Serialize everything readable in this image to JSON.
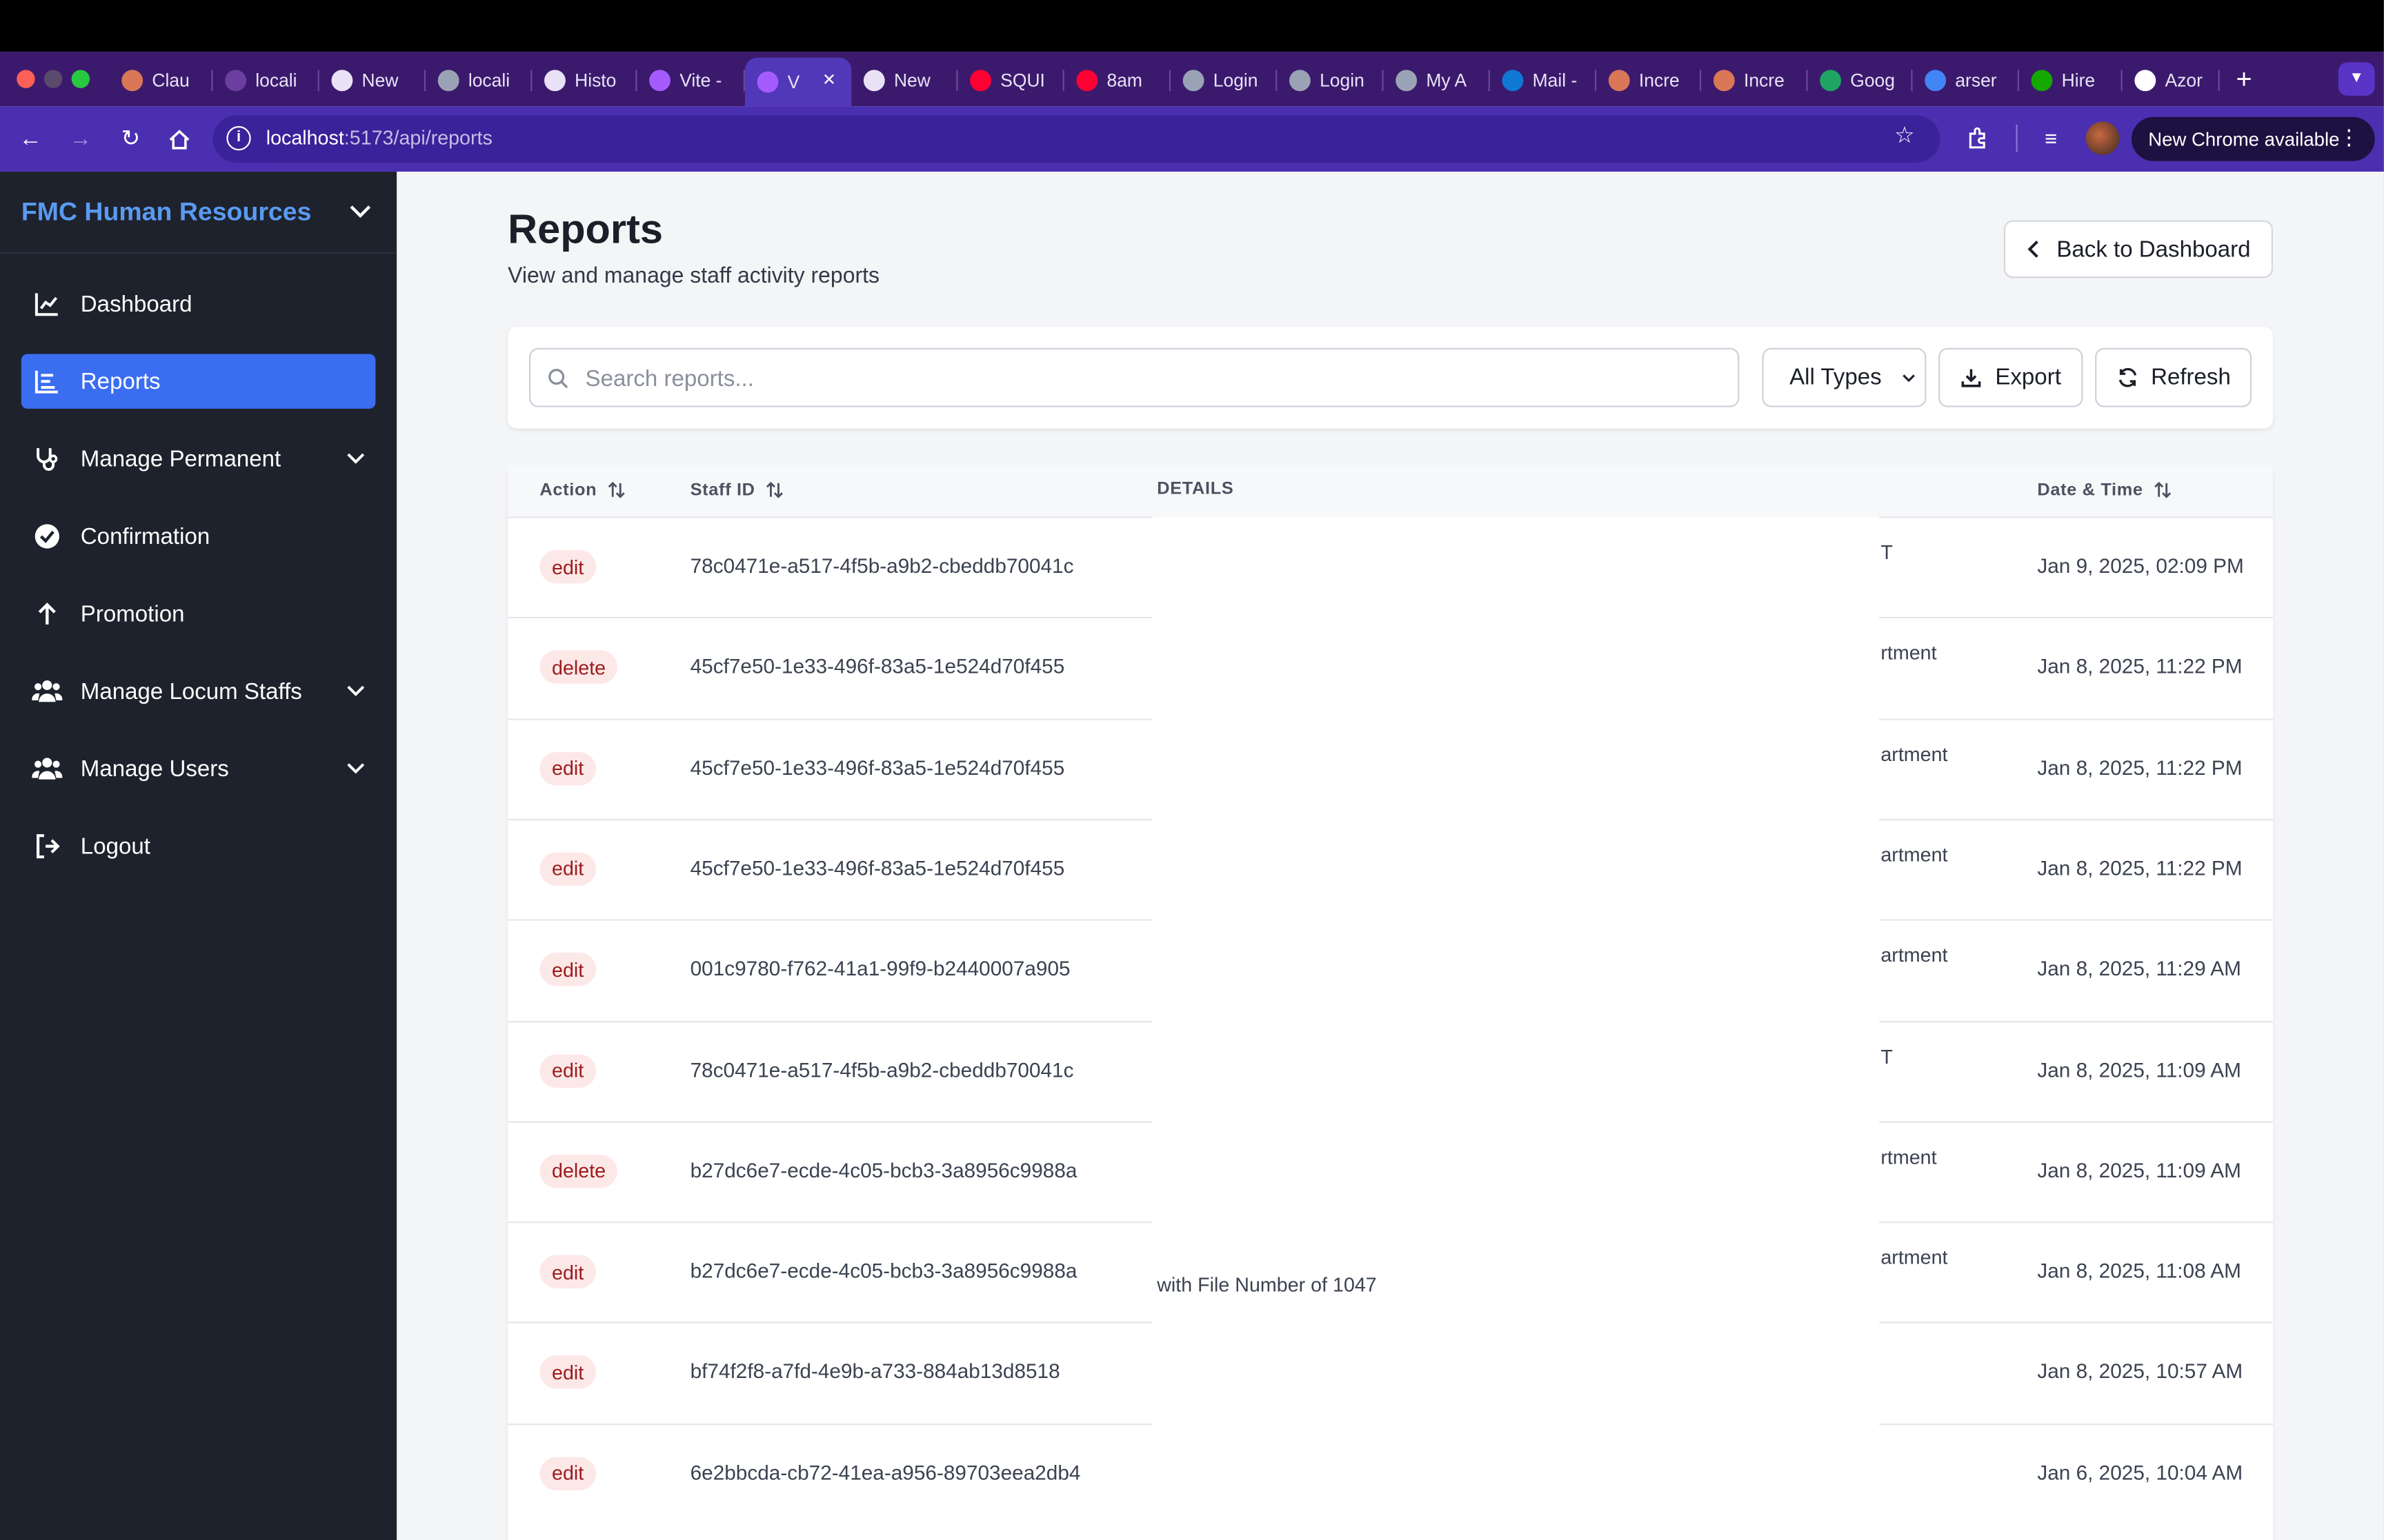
{
  "browser": {
    "tabs": [
      {
        "title": "Clau",
        "icon": "claude-icon"
      },
      {
        "title": "locali",
        "icon": "app-icon"
      },
      {
        "title": "New",
        "icon": "chrome-icon"
      },
      {
        "title": "locali",
        "icon": "globe-icon"
      },
      {
        "title": "Histo",
        "icon": "history-icon"
      },
      {
        "title": "Vite -",
        "icon": "vite-icon"
      },
      {
        "title": "V",
        "icon": "vite-icon",
        "active": true
      },
      {
        "title": "New",
        "icon": "chrome-icon"
      },
      {
        "title": "SQUI",
        "icon": "youtube-icon"
      },
      {
        "title": "8am",
        "icon": "youtube-icon"
      },
      {
        "title": "Login",
        "icon": "globe-icon"
      },
      {
        "title": "Login",
        "icon": "globe-icon"
      },
      {
        "title": "My A",
        "icon": "globe-icon"
      },
      {
        "title": "Mail -",
        "icon": "outlook-icon"
      },
      {
        "title": "Incre",
        "icon": "claude-icon"
      },
      {
        "title": "Incre",
        "icon": "claude-icon"
      },
      {
        "title": "Goog",
        "icon": "drive-icon"
      },
      {
        "title": "arser",
        "icon": "google-icon"
      },
      {
        "title": "Hire",
        "icon": "upwork-icon"
      },
      {
        "title": "Azor",
        "icon": "github-icon"
      }
    ],
    "url_host": "localhost",
    "url_path": ":5173/api/reports",
    "update_label": "New Chrome available"
  },
  "sidebar": {
    "brand": "FMC Human Resources",
    "items": [
      {
        "label": "Dashboard",
        "icon": "chart-line-icon"
      },
      {
        "label": "Reports",
        "icon": "report-list-icon",
        "active": true
      },
      {
        "label": "Manage Permanent",
        "icon": "stethoscope-icon",
        "expandable": true
      },
      {
        "label": "Confirmation",
        "icon": "check-circle-icon"
      },
      {
        "label": "Promotion",
        "icon": "arrow-up-icon"
      },
      {
        "label": "Manage Locum Staffs",
        "icon": "users-icon",
        "expandable": true
      },
      {
        "label": "Manage Users",
        "icon": "users-icon",
        "expandable": true
      },
      {
        "label": "Logout",
        "icon": "logout-icon"
      }
    ]
  },
  "header": {
    "title": "Reports",
    "subtitle": "View and manage staff activity reports",
    "back_label": "Back to Dashboard"
  },
  "filters": {
    "search_placeholder": "Search reports...",
    "type_selected": "All Types",
    "export_label": "Export",
    "refresh_label": "Refresh"
  },
  "table": {
    "columns": {
      "action": "Action",
      "staff_id": "Staff ID",
      "details": "DETAILS",
      "datetime": "Date & Time"
    },
    "rows": [
      {
        "action": "edit",
        "staff_id": "78c0471e-a517-4f5b-a9b2-cbeddb70041c",
        "detail_tail": "T",
        "detail_extra": "",
        "datetime": "Jan 9, 2025, 02:09 PM"
      },
      {
        "action": "delete",
        "staff_id": "45cf7e50-1e33-496f-83a5-1e524d70f455",
        "detail_tail": "rtment",
        "detail_extra": "",
        "datetime": "Jan 8, 2025, 11:22 PM"
      },
      {
        "action": "edit",
        "staff_id": "45cf7e50-1e33-496f-83a5-1e524d70f455",
        "detail_tail": "artment",
        "detail_extra": "",
        "datetime": "Jan 8, 2025, 11:22 PM"
      },
      {
        "action": "edit",
        "staff_id": "45cf7e50-1e33-496f-83a5-1e524d70f455",
        "detail_tail": "artment",
        "detail_extra": "",
        "datetime": "Jan 8, 2025, 11:22 PM"
      },
      {
        "action": "edit",
        "staff_id": "001c9780-f762-41a1-99f9-b2440007a905",
        "detail_tail": "artment",
        "detail_extra": "",
        "datetime": "Jan 8, 2025, 11:29 AM"
      },
      {
        "action": "edit",
        "staff_id": "78c0471e-a517-4f5b-a9b2-cbeddb70041c",
        "detail_tail": "T",
        "detail_extra": "",
        "datetime": "Jan 8, 2025, 11:09 AM"
      },
      {
        "action": "delete",
        "staff_id": "b27dc6e7-ecde-4c05-bcb3-3a8956c9988a",
        "detail_tail": "rtment",
        "detail_extra": "",
        "datetime": "Jan 8, 2025, 11:09 AM"
      },
      {
        "action": "edit",
        "staff_id": "b27dc6e7-ecde-4c05-bcb3-3a8956c9988a",
        "detail_tail": "artment",
        "detail_extra": "with File Number of 1047",
        "datetime": "Jan 8, 2025, 11:08 AM"
      },
      {
        "action": "edit",
        "staff_id": "bf74f2f8-a7fd-4e9b-a733-884ab13d8518",
        "detail_tail": "",
        "detail_extra": "",
        "datetime": "Jan 8, 2025, 10:57 AM"
      },
      {
        "action": "edit",
        "staff_id": "6e2bbcda-cb72-41ea-a956-89703eea2db4",
        "detail_tail": "",
        "detail_extra": "",
        "datetime": "Jan 6, 2025, 10:04 AM"
      }
    ]
  },
  "colors": {
    "sidebar_bg": "#1e222c",
    "brand": "#5a9af0",
    "active_nav": "#3a6df0",
    "badge_bg": "#fde8e8",
    "badge_text": "#9b1c1c",
    "toolbar": "#4a2fb0",
    "tabstrip": "#3b1a6d"
  }
}
